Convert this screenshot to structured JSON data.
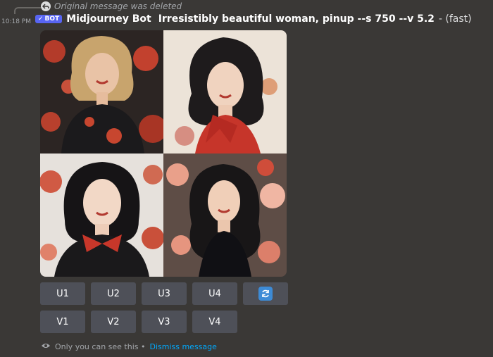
{
  "reply": {
    "text": "Original message was deleted"
  },
  "message": {
    "timestamp": "10:18 PM",
    "badge": "BOT",
    "username": "Midjourney Bot",
    "prompt": "Irresistibly beautiful woman, pinup --s 750 --v 5.2",
    "mode": "- (fast)"
  },
  "images": [
    {
      "name": "image-1",
      "theme": "dark dress, red flowers"
    },
    {
      "name": "image-2",
      "theme": "red scarf, white background"
    },
    {
      "name": "image-3",
      "theme": "red bow, floral background"
    },
    {
      "name": "image-4",
      "theme": "dark top, pink flowers"
    }
  ],
  "buttons": {
    "upscale": [
      "U1",
      "U2",
      "U3",
      "U4"
    ],
    "variation": [
      "V1",
      "V2",
      "V3",
      "V4"
    ]
  },
  "footer": {
    "note": "Only you can see this •",
    "dismiss": "Dismiss message"
  },
  "colors": {
    "background": "#3a3836",
    "button": "#4e5058",
    "link": "#00a8fc",
    "bot_badge": "#5865f2"
  }
}
